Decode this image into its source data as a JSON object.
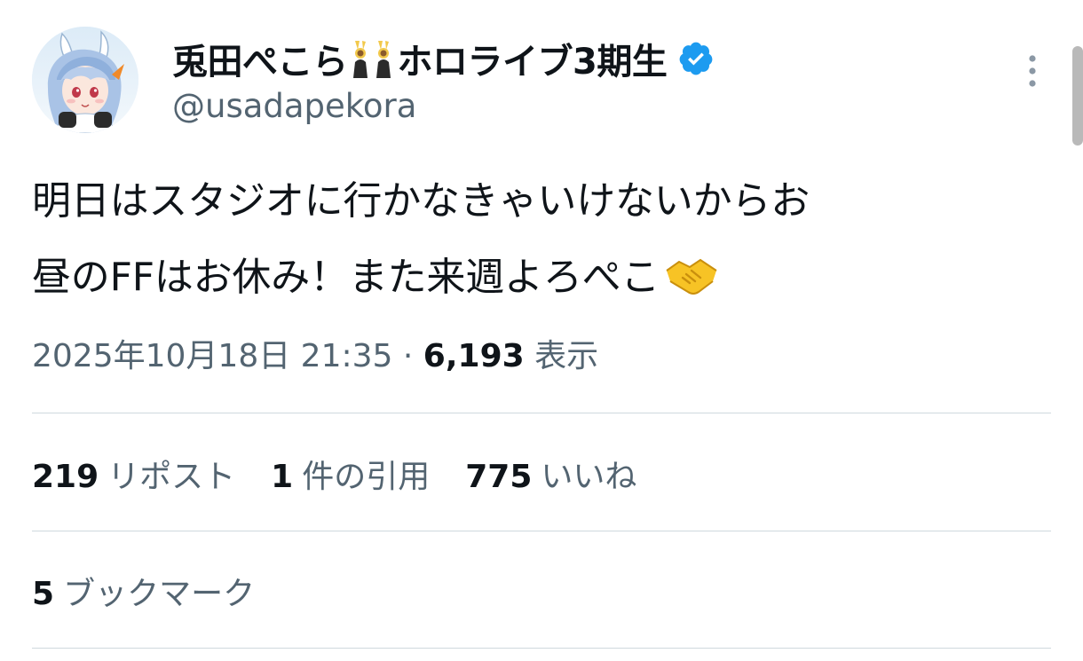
{
  "author": {
    "display_name_prefix": "兎田ぺこら",
    "display_name_suffix": "ホロライブ3期生",
    "name_emoji": "bunny-girls-emoji",
    "handle": "@usadapekora",
    "verified_icon": "verified-badge-icon",
    "verified_color": "#1d9bf0",
    "avatar": "user-avatar"
  },
  "tweet": {
    "line1": "明日はスタジオに行かなきゃいけないからお",
    "line2": "昼のFFはお休み！また来週よろぺこ",
    "trailing_emoji": "handshake-emoji"
  },
  "meta": {
    "timestamp": "2025年10月18日 21:35",
    "separator": "·",
    "views_count": "6,193",
    "views_label": "表示"
  },
  "stats": {
    "reposts_count": "219",
    "reposts_label": "リポスト",
    "quotes_count": "1",
    "quotes_label": "件の引用",
    "likes_count": "775",
    "likes_label": "いいね"
  },
  "bookmarks": {
    "count": "5",
    "label": "ブックマーク"
  },
  "colors": {
    "primary_text": "#0f1419",
    "secondary_text": "#536471",
    "divider": "#cfd9de"
  }
}
